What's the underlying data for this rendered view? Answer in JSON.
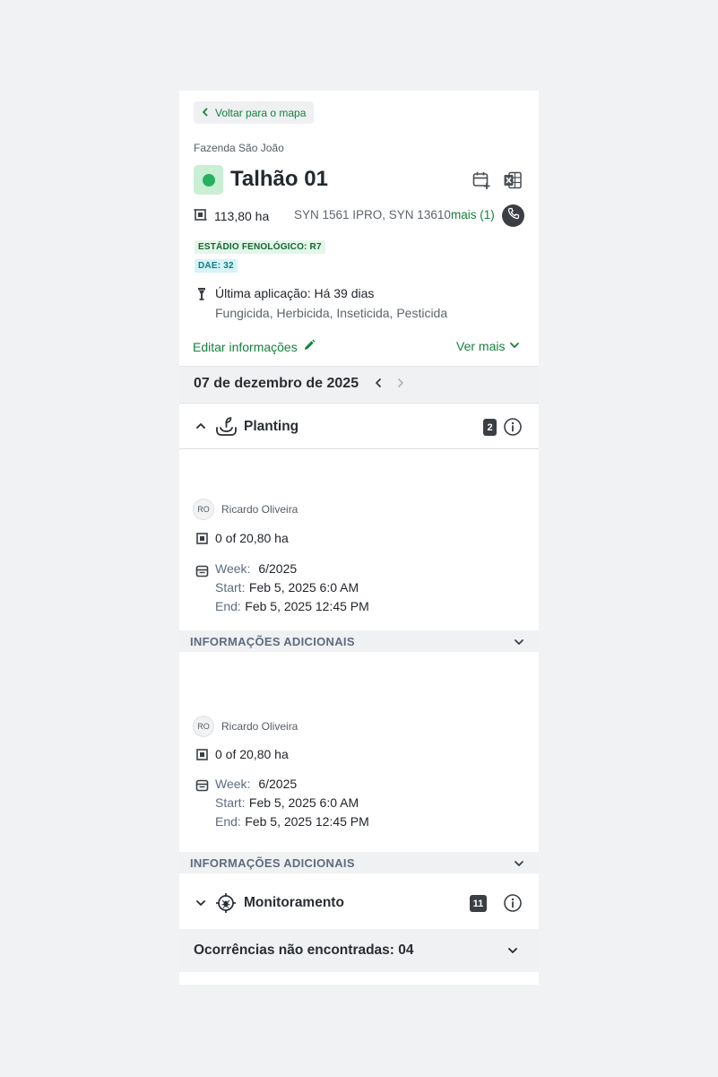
{
  "back_button": {
    "label": "Voltar para o mapa"
  },
  "farm_name": "Fazenda São João",
  "field": {
    "title": "Talhão 01",
    "status_color": "#26b160",
    "area": "113,80 ha",
    "varieties": "SYN 1561 IPRO, SYN 13610",
    "more_link": "mais (1)"
  },
  "badges": {
    "phenology": "ESTÁDIO FENOLÓGICO: R7",
    "dae": "DAE: 32"
  },
  "last_application": {
    "title": "Última aplicação: Há 39 dias",
    "products": "Fungicida, Herbicida, Inseticida, Pesticida"
  },
  "actions": {
    "edit_label": "Editar informações",
    "see_more_label": "Ver mais"
  },
  "date_nav": {
    "date": "07 de dezembro de 2025"
  },
  "planting": {
    "title": "Planting",
    "count": "2",
    "cards": [
      {
        "initials": "RO",
        "user": "Ricardo Oliveira",
        "progress": "0 of 20,80 ha",
        "week_label": "Week:",
        "week_value": "6/2025",
        "start_label": "Start:",
        "start_value": "Feb 5, 2025 6:0 AM",
        "end_label": "End:",
        "end_value": "Feb 5, 2025 12:45 PM",
        "info_label": "INFORMAÇÕES ADICIONAIS"
      },
      {
        "initials": "RO",
        "user": "Ricardo Oliveira",
        "progress": "0 of 20,80 ha",
        "week_label": "Week:",
        "week_value": "6/2025",
        "start_label": "Start:",
        "start_value": "Feb 5, 2025 6:0 AM",
        "end_label": "End:",
        "end_value": "Feb 5, 2025 12:45 PM",
        "info_label": "INFORMAÇÕES ADICIONAIS"
      }
    ]
  },
  "monitoring": {
    "title": "Monitoramento",
    "count": "11"
  },
  "occurrences": {
    "label": "Ocorrências não encontradas: 04"
  },
  "colors": {
    "accent": "#15803d",
    "dark": "#3b3f44",
    "muted": "#5d6b80"
  },
  "icons": [
    "chevron-left-icon",
    "calendar-add-icon",
    "excel-icon",
    "area-icon",
    "phone-icon",
    "spray-icon",
    "pencil-icon",
    "chevron-down-icon",
    "chevron-right-icon",
    "chevron-up-icon",
    "planting-icon",
    "info-icon",
    "calendar-icon",
    "pest-icon"
  ]
}
